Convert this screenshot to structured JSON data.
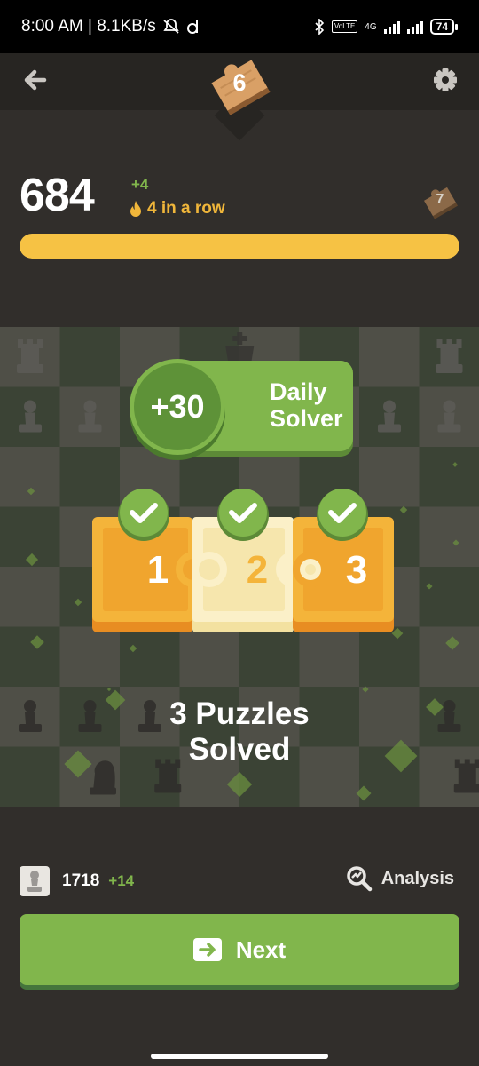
{
  "status_bar": {
    "time_speed": "8:00 AM | 8.1KB/s",
    "network": "4G",
    "battery": "74"
  },
  "header": {
    "level": "6"
  },
  "stats": {
    "score": "684",
    "score_delta": "+4",
    "streak": "4 in a row",
    "next_level": "7",
    "progress_fraction": 1.0
  },
  "award": {
    "points": "+30",
    "label_line1": "Daily",
    "label_line2": "Solver"
  },
  "puzzles": [
    "1",
    "2",
    "3"
  ],
  "result": {
    "line1": "3 Puzzles",
    "line2": "Solved"
  },
  "rating": {
    "value": "1718",
    "delta": "+14",
    "analysis_label": "Analysis"
  },
  "next_button": {
    "label": "Next"
  },
  "colors": {
    "accent_green": "#81b64c",
    "gold": "#f6c244",
    "background": "#312e2b"
  }
}
